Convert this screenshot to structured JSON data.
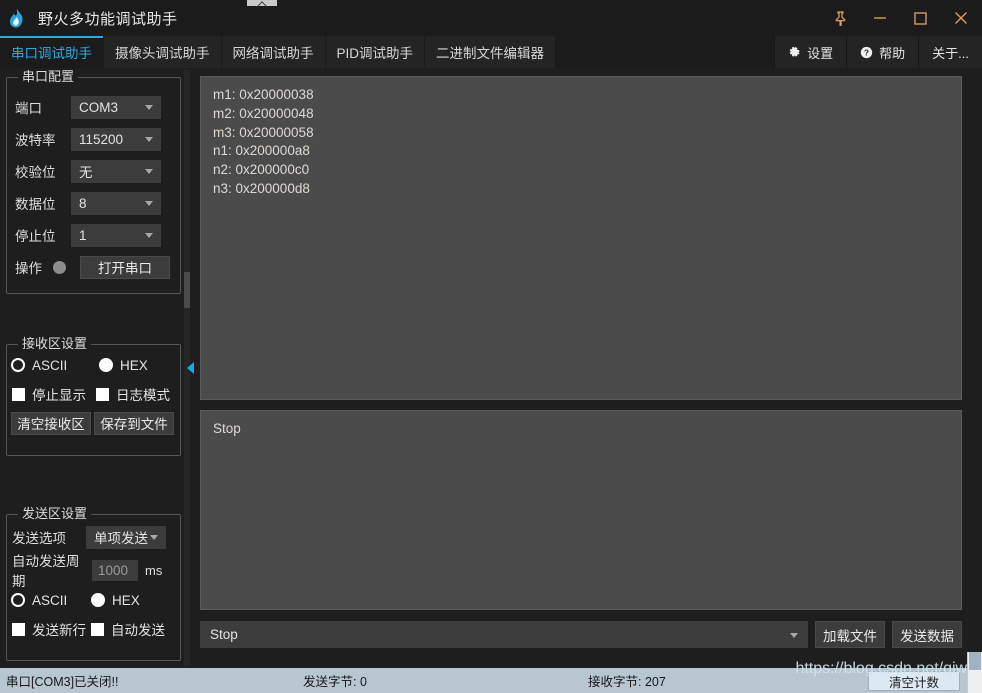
{
  "window": {
    "title": "野火多功能调试助手",
    "logo_icon": "flame-icon",
    "controls": [
      {
        "name": "pin",
        "icon": "pin-icon"
      },
      {
        "name": "minimize",
        "icon": "minimize-icon"
      },
      {
        "name": "maximize",
        "icon": "maximize-icon"
      },
      {
        "name": "close",
        "icon": "close-icon"
      }
    ]
  },
  "tabs": [
    {
      "label": "串口调试助手",
      "active": true
    },
    {
      "label": "摄像头调试助手",
      "active": false
    },
    {
      "label": "网络调试助手",
      "active": false
    },
    {
      "label": "PID调试助手",
      "active": false
    },
    {
      "label": "二进制文件编辑器",
      "active": false
    }
  ],
  "toolbar": {
    "settings_label": "设置",
    "settings_icon": "gear-icon",
    "help_label": "帮助",
    "help_icon": "question-circle-icon",
    "about_label": "关于..."
  },
  "serial_config": {
    "title": "串口配置",
    "port_label": "端口",
    "port_value": "COM3",
    "baud_label": "波特率",
    "baud_value": "115200",
    "parity_label": "校验位",
    "parity_value": "无",
    "data_bits_label": "数据位",
    "data_bits_value": "8",
    "stop_bits_label": "停止位",
    "stop_bits_value": "1",
    "operation_label": "操作",
    "open_button": "打开串口",
    "led_color": "#8d8d8d"
  },
  "receive_settings": {
    "title": "接收区设置",
    "ascii_label": "ASCII",
    "hex_label": "HEX",
    "format_selected": "ASCII",
    "stop_display_label": "停止显示",
    "stop_display_checked": false,
    "log_mode_label": "日志模式",
    "log_mode_checked": false,
    "clear_button": "清空接收区",
    "save_button": "保存到文件"
  },
  "send_settings": {
    "title": "发送区设置",
    "send_option_label": "发送选项",
    "send_option_value": "单项发送",
    "auto_period_label": "自动发送周期",
    "auto_period_value": "1000",
    "auto_period_unit": "ms",
    "ascii_label": "ASCII",
    "hex_label": "HEX",
    "format_selected": "ASCII",
    "newline_label": "发送新行",
    "newline_checked": false,
    "auto_send_label": "自动发送",
    "auto_send_checked": false
  },
  "receive_area": {
    "lines": [
      "m1: 0x20000038",
      "m2: 0x20000048",
      "m3: 0x20000058",
      "n1: 0x200000a8",
      "n2: 0x200000c0",
      "n3: 0x200000d8"
    ]
  },
  "send_area": {
    "text": "Stop"
  },
  "send_bar": {
    "combo_value": "Stop",
    "load_file_button": "加载文件",
    "send_data_button": "发送数据"
  },
  "statusbar": {
    "connection": "串口[COM3]已关闭!!",
    "tx": "发送字节: 0",
    "rx": "接收字节: 207",
    "clear_count_button": "清空计数"
  },
  "watermark": {
    "text": "https://blog.csdn.net/qiwn"
  },
  "theme": {
    "accent": "#2ea8e0",
    "window_bg": "#1e1e1e",
    "panel_bg": "#4b4b4b",
    "control_bg": "#3c3c3c",
    "status_bg": "#b8c6d0",
    "win_ctrl_color": "#d79b63"
  }
}
